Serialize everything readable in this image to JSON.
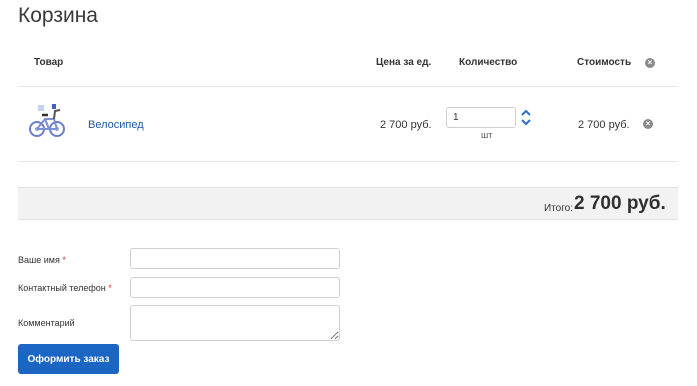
{
  "page": {
    "title": "Корзина"
  },
  "table": {
    "headers": {
      "product": "Товар",
      "price": "Цена за ед.",
      "quantity": "Количество",
      "cost": "Стоимость",
      "clear_icon": "close-circle-icon"
    },
    "rows": [
      {
        "image_icon": "bicycle-image",
        "name": "Велосипед",
        "price": "2 700 руб.",
        "quantity": "1",
        "unit": "шт",
        "cost": "2 700 руб.",
        "remove_icon": "close-circle-icon"
      }
    ]
  },
  "summary": {
    "total_label": "Итого:",
    "total_value": "2 700 руб."
  },
  "form": {
    "name_label": "Ваше имя",
    "phone_label": "Контактный телефон",
    "comment_label": "Комментарий",
    "required_mark": "*",
    "name_value": "",
    "phone_value": "",
    "comment_value": "",
    "submit_label": "Оформить заказ"
  },
  "colors": {
    "accent": "#1a66c2",
    "link": "#1c5aa8",
    "required": "#d9312b",
    "summary_bg": "#f2f2f2"
  }
}
